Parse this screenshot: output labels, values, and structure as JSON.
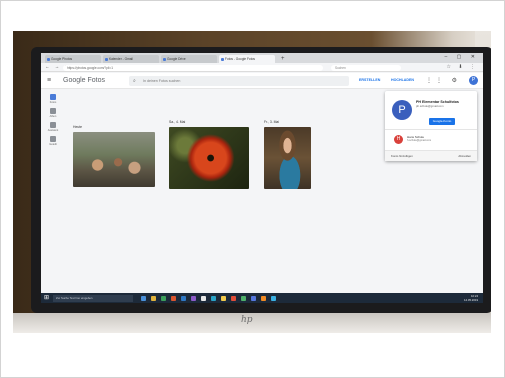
{
  "tabs": [
    {
      "label": "Google Photos",
      "active": false
    },
    {
      "label": "Kalender - Gmail",
      "active": false
    },
    {
      "label": "Google Drive",
      "active": false
    },
    {
      "label": "Fotos - Google Fotos",
      "active": true
    }
  ],
  "address": {
    "url": "https://photos.google.com/?pli=1",
    "search_placeholder": "Suchen"
  },
  "app": {
    "brand": "Google Fotos",
    "search_placeholder": "In deinen Fotos suchen",
    "create_label": "ERSTELLEN",
    "upload_label": "HOCHLADEN",
    "avatar_letter": "P"
  },
  "sidebar": [
    {
      "label": "Fotos",
      "active": true
    },
    {
      "label": "Alben",
      "active": false
    },
    {
      "label": "Assistent",
      "active": false
    },
    {
      "label": "Geteilt",
      "active": false
    }
  ],
  "photo_groups": [
    {
      "date": "Heute",
      "photo": "classroom"
    },
    {
      "date": "Sa., 4. Mai",
      "photo": "red-poppy"
    },
    {
      "date": "Fr., 3. Mai",
      "photo": "girl-portrait"
    }
  ],
  "account_card": {
    "avatar_letter": "P",
    "name": "PH Elementar Schulfotos",
    "email": "ph.schule@gmail.com",
    "account_button": "Google-Konto",
    "other_account_letter": "H",
    "other_account_name": "Hans Schule",
    "other_account_email": "h.schule@gmail.com",
    "add_account": "Konto hinzufügen",
    "sign_out": "Abmelden"
  },
  "taskbar": {
    "search_placeholder": "Zur Suche Text hier eingeben",
    "time": "10:24",
    "date": "14.05.2019"
  },
  "colors": {
    "accent": "#1a73e8",
    "avatar": "#3a5fbd",
    "taskbar": "#1d2a3a"
  }
}
